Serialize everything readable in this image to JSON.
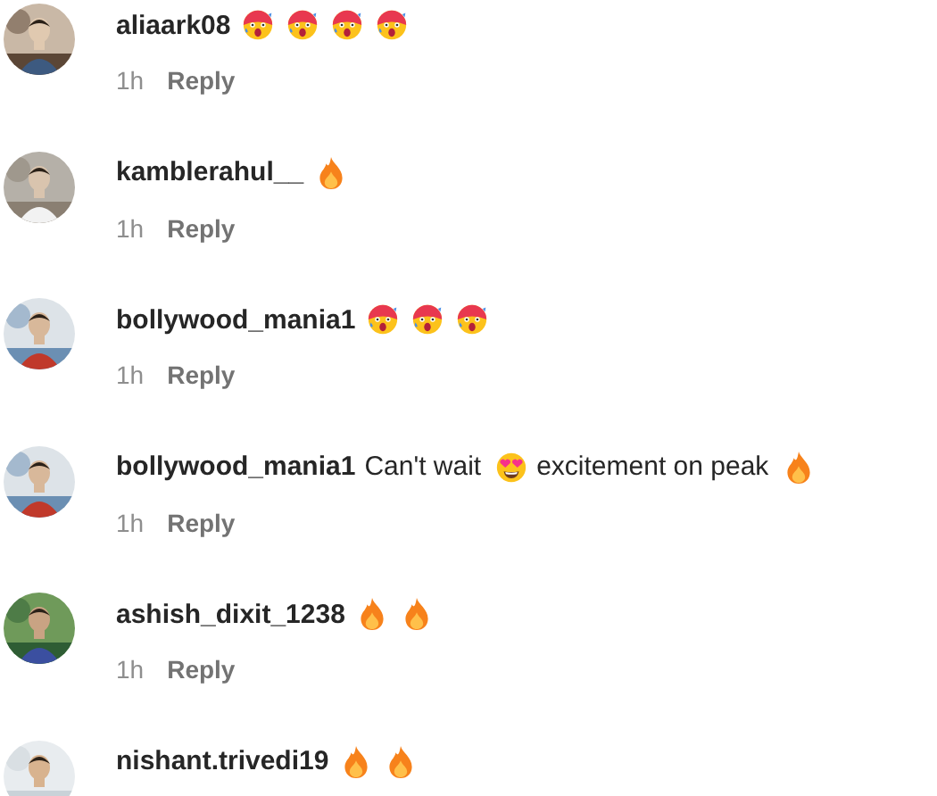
{
  "comments": [
    {
      "username": "aliaark08",
      "segments": [
        {
          "kind": "shocked"
        },
        {
          "kind": "shocked"
        },
        {
          "kind": "shocked"
        },
        {
          "kind": "shocked"
        }
      ],
      "time": "1h",
      "reply": "Reply",
      "avatar": {
        "kind": "picture"
      }
    },
    {
      "username": "kamblerahul__",
      "segments": [
        {
          "kind": "fire"
        }
      ],
      "time": "1h",
      "reply": "Reply",
      "avatar": {
        "kind": "picture"
      }
    },
    {
      "username": "bollywood_mania1",
      "segments": [
        {
          "kind": "shocked"
        },
        {
          "kind": "shocked"
        },
        {
          "kind": "shocked"
        }
      ],
      "time": "1h",
      "reply": "Reply",
      "avatar": {
        "kind": "picture"
      }
    },
    {
      "username": "bollywood_mania1",
      "segments": [
        {
          "kind": "text",
          "text": "Can't wait"
        },
        {
          "kind": "heart_eyes"
        },
        {
          "kind": "text",
          "text": "excitement on peak"
        },
        {
          "kind": "fire"
        }
      ],
      "time": "1h",
      "reply": "Reply",
      "avatar": {
        "kind": "picture"
      }
    },
    {
      "username": "ashish_dixit_1238",
      "segments": [
        {
          "kind": "fire"
        },
        {
          "kind": "fire"
        }
      ],
      "time": "1h",
      "reply": "Reply",
      "avatar": {
        "kind": "picture"
      }
    },
    {
      "username": "nishant.trivedi19",
      "segments": [
        {
          "kind": "fire"
        },
        {
          "kind": "fire"
        }
      ],
      "avatar": {
        "kind": "picture"
      }
    }
  ]
}
